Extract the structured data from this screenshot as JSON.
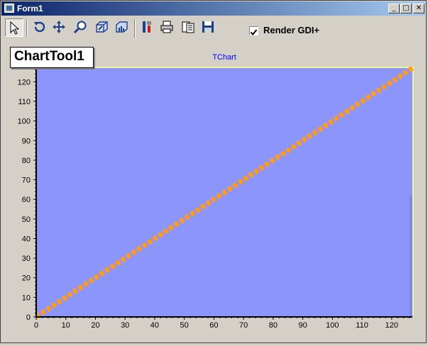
{
  "window": {
    "title": "Form1"
  },
  "caption_buttons": {
    "minimize": "_",
    "maximize": "□",
    "close": "✕"
  },
  "toolbar": {
    "buttons": [
      {
        "name": "select-pointer-button",
        "icon": "cursor-icon",
        "pressed": true
      },
      {
        "name": "rotate-button",
        "icon": "rotate-icon"
      },
      {
        "name": "pan-button",
        "icon": "move-arrows-icon"
      },
      {
        "name": "zoom-button",
        "icon": "magnifier-icon"
      },
      {
        "name": "3d-depth-button",
        "icon": "3d-box-icon"
      },
      {
        "name": "3d-view-button",
        "icon": "3d-chart-icon"
      },
      {
        "name": "edit-chart-button",
        "icon": "tools-icon"
      },
      {
        "name": "print-button",
        "icon": "printer-icon"
      },
      {
        "name": "preview-button",
        "icon": "print-preview-icon"
      },
      {
        "name": "save-button",
        "icon": "floppy-disk-icon"
      }
    ],
    "checkbox": {
      "label": "Render GDI+",
      "checked": true
    }
  },
  "chart_tool_label": "ChartTool1",
  "colors": {
    "plot_bg": "#8c96fa",
    "series": "#ff9a1a",
    "title": "#0000ff",
    "panel": "#d4d0c8",
    "wall_edge": "#f2f5a0"
  },
  "chart_data": {
    "type": "line",
    "title": "TChart",
    "x": [
      0,
      127
    ],
    "y": [
      0,
      127
    ],
    "xlim": [
      0,
      127
    ],
    "ylim": [
      0,
      127
    ],
    "x_ticks": [
      "0",
      "10",
      "20",
      "30",
      "40",
      "50",
      "60",
      "70",
      "80",
      "90",
      "100",
      "110",
      "120"
    ],
    "y_ticks": [
      "0",
      "10",
      "20",
      "30",
      "40",
      "50",
      "60",
      "70",
      "80",
      "90",
      "100",
      "110",
      "120"
    ],
    "line_style": "dashed",
    "grid": false,
    "legend": "none"
  }
}
